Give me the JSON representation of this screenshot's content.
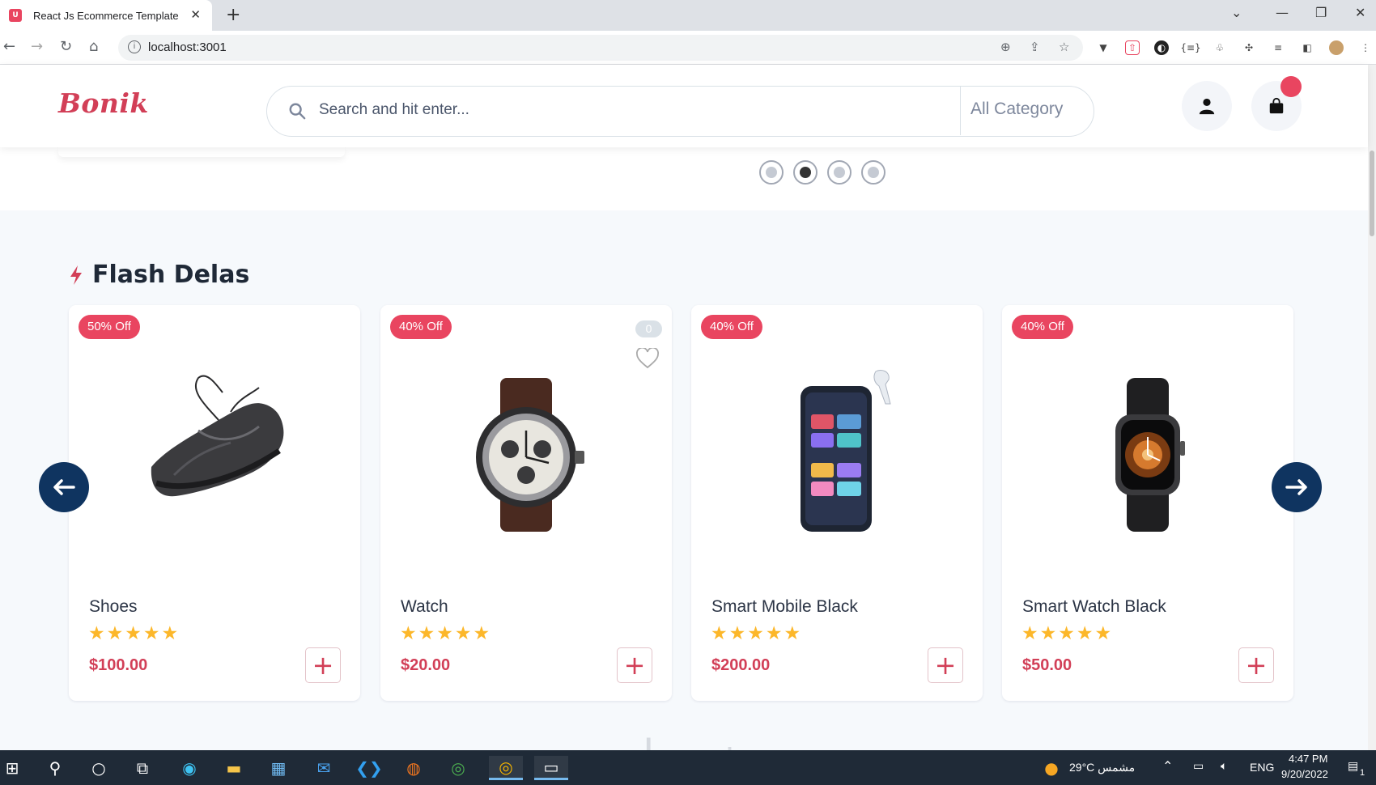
{
  "browser": {
    "tab_title": "React Js Ecommerce Template",
    "tab_favicon": "U",
    "url": "localhost:3001"
  },
  "header": {
    "logo": "Bonik",
    "search_placeholder": "Search and hit enter...",
    "category": "All Category"
  },
  "hero": {
    "slides_total": 4,
    "active_slide": 2
  },
  "flash": {
    "title": "Flash Delas",
    "products": [
      {
        "name": "Shoes",
        "price": "$100.00",
        "discount": "50% Off",
        "rating": 5
      },
      {
        "name": "Watch",
        "price": "$20.00",
        "discount": "40% Off",
        "rating": 5,
        "likes": "0"
      },
      {
        "name": "Smart Mobile Black",
        "price": "$200.00",
        "discount": "40% Off",
        "rating": 5
      },
      {
        "name": "Smart Watch Black",
        "price": "$50.00",
        "discount": "40% Off",
        "rating": 5
      }
    ]
  },
  "taskbar": {
    "weather": "29°C مشمس",
    "language": "ENG",
    "time": "4:47 PM",
    "date": "9/20/2022",
    "notifications": "1"
  },
  "colors": {
    "brand": "#d23f57",
    "badge": "#e94560",
    "nav_arrow": "#0f3460",
    "star": "#fcb72a"
  }
}
